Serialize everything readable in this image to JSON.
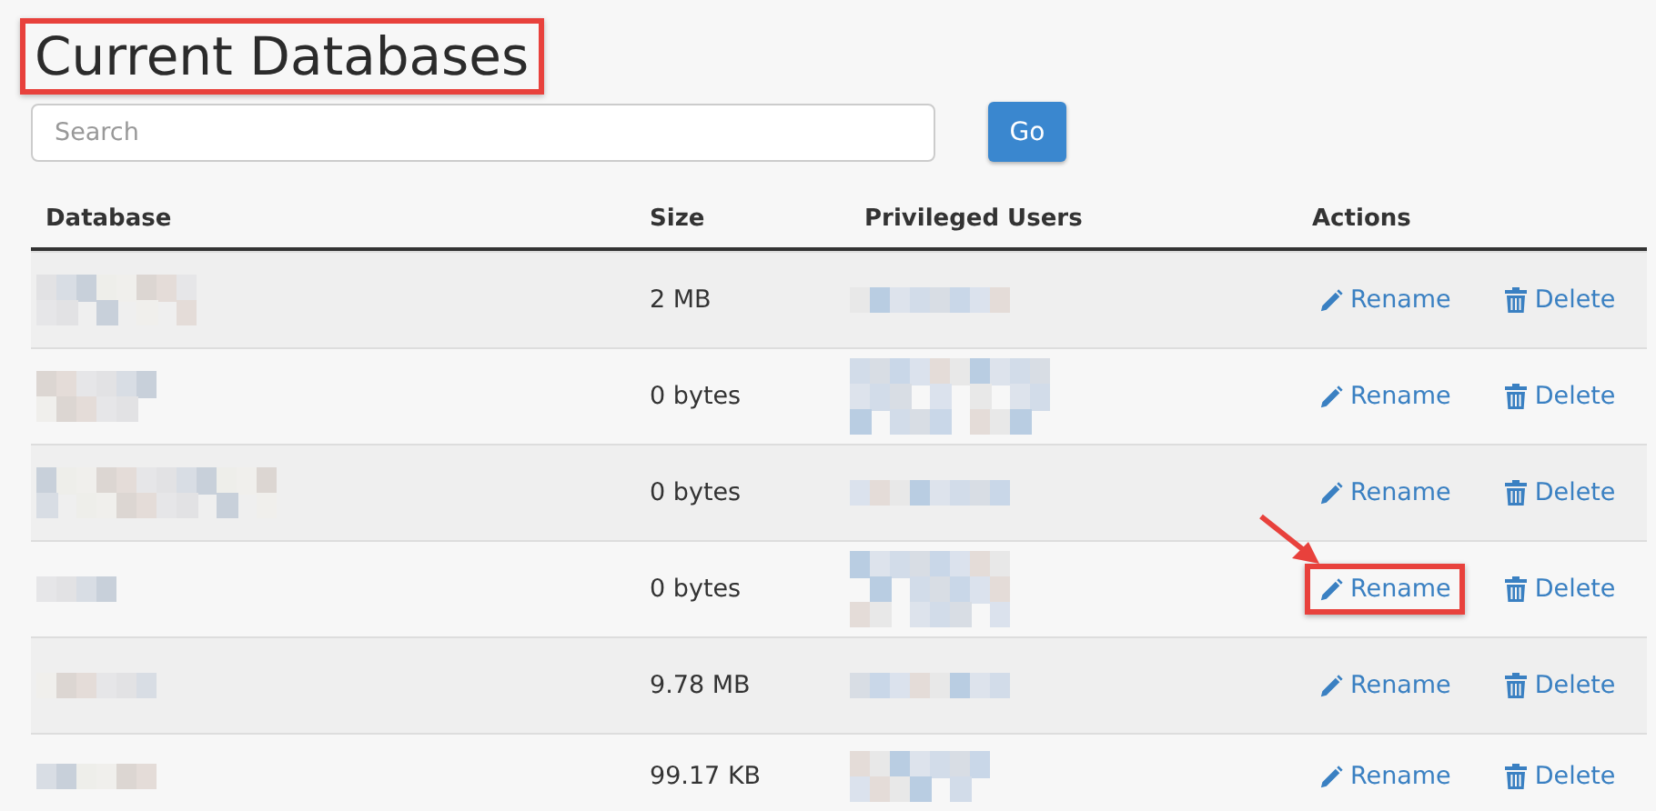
{
  "title": {
    "text": "Current Databases",
    "highlighted": true
  },
  "search": {
    "placeholder": "Search",
    "button": "Go"
  },
  "table": {
    "columns": [
      "Database",
      "Size",
      "Privileged Users",
      "Actions"
    ],
    "rows": [
      {
        "size": "2 MB",
        "actions": [
          {
            "kind": "rename",
            "label": "Rename",
            "highlighted": false,
            "pointer": false
          },
          {
            "kind": "delete",
            "label": "Delete"
          }
        ]
      },
      {
        "size": "0 bytes",
        "actions": [
          {
            "kind": "rename",
            "label": "Rename",
            "highlighted": false,
            "pointer": false
          },
          {
            "kind": "delete",
            "label": "Delete"
          }
        ]
      },
      {
        "size": "0 bytes",
        "actions": [
          {
            "kind": "rename",
            "label": "Rename",
            "highlighted": false,
            "pointer": false
          },
          {
            "kind": "delete",
            "label": "Delete"
          }
        ]
      },
      {
        "size": "0 bytes",
        "actions": [
          {
            "kind": "rename",
            "label": "Rename",
            "highlighted": true,
            "pointer": true
          },
          {
            "kind": "delete",
            "label": "Delete"
          }
        ]
      },
      {
        "size": "9.78 MB",
        "actions": [
          {
            "kind": "rename",
            "label": "Rename",
            "highlighted": false,
            "pointer": false
          },
          {
            "kind": "delete",
            "label": "Delete"
          }
        ]
      },
      {
        "size": "99.17 KB",
        "actions": [
          {
            "kind": "rename",
            "label": "Rename",
            "highlighted": false,
            "pointer": false
          },
          {
            "kind": "delete",
            "label": "Delete"
          }
        ]
      }
    ]
  }
}
